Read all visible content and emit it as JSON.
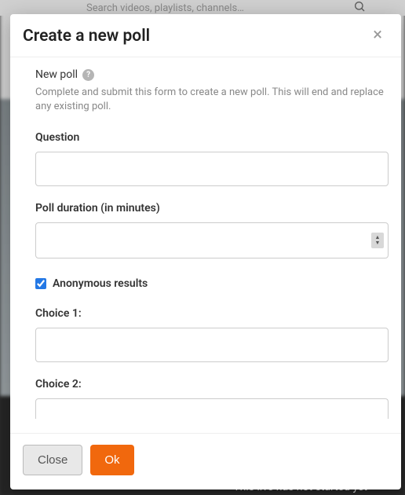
{
  "background": {
    "search_placeholder": "Search videos, playlists, channels…",
    "status_text": "This live has not started yet"
  },
  "modal": {
    "title": "Create a new poll",
    "close_x": "×",
    "section_label": "New poll",
    "help_text": "Complete and submit this form to create a new poll. This will end and replace any existing poll.",
    "question_label": "Question",
    "duration_label": "Poll duration (in minutes)",
    "anonymous_label": "Anonymous results",
    "anonymous_checked": true,
    "choice1_label": "Choice 1:",
    "choice2_label": "Choice 2:",
    "close_button": "Close",
    "ok_button": "Ok"
  }
}
